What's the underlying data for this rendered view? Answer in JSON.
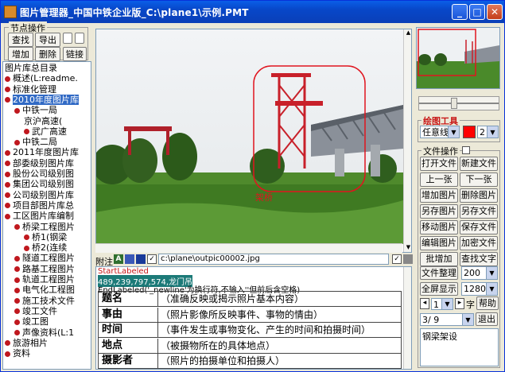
{
  "window": {
    "title": "图片管理器_中国中铁企业版_C:\\plane1\\示例.PMT"
  },
  "titlebar_buttons": {
    "minimize": "_",
    "maximize": "□",
    "close": "✕"
  },
  "node_ops": {
    "label": "节点操作",
    "find": "查找",
    "export": "导出",
    "add": "增加",
    "delete": "删除",
    "link": "链接"
  },
  "tree": {
    "items": [
      {
        "label": "图片库总目录",
        "indent": 0,
        "bullet": false,
        "selected": false
      },
      {
        "label": "概述(L:readme.",
        "indent": 0,
        "bullet": true,
        "selected": false
      },
      {
        "label": "标准化管理",
        "indent": 0,
        "bullet": true,
        "selected": false
      },
      {
        "label": "2010年度图片库",
        "indent": 0,
        "bullet": true,
        "selected": true
      },
      {
        "label": "中铁一局",
        "indent": 1,
        "bullet": true,
        "selected": false
      },
      {
        "label": "京沪高速(",
        "indent": 2,
        "bullet": false,
        "selected": false
      },
      {
        "label": "武广高速",
        "indent": 2,
        "bullet": true,
        "selected": false
      },
      {
        "label": "中铁二局",
        "indent": 1,
        "bullet": true,
        "selected": false
      },
      {
        "label": "2011年度图片库",
        "indent": 0,
        "bullet": true,
        "selected": false
      },
      {
        "label": "部委级别图片库",
        "indent": 0,
        "bullet": true,
        "selected": false
      },
      {
        "label": "股份公司级别图",
        "indent": 0,
        "bullet": true,
        "selected": false
      },
      {
        "label": "集团公司级别图",
        "indent": 0,
        "bullet": true,
        "selected": false
      },
      {
        "label": "公司级别图片库",
        "indent": 0,
        "bullet": true,
        "selected": false
      },
      {
        "label": "项目部图片库总",
        "indent": 0,
        "bullet": true,
        "selected": false
      },
      {
        "label": "工区图片库编制",
        "indent": 0,
        "bullet": true,
        "selected": false
      },
      {
        "label": "桥梁工程图片",
        "indent": 1,
        "bullet": true,
        "selected": false
      },
      {
        "label": "桥1(钢梁",
        "indent": 2,
        "bullet": true,
        "selected": false
      },
      {
        "label": "桥2(连续",
        "indent": 2,
        "bullet": true,
        "selected": false
      },
      {
        "label": "隧道工程图片",
        "indent": 1,
        "bullet": true,
        "selected": false
      },
      {
        "label": "路基工程图片",
        "indent": 1,
        "bullet": true,
        "selected": false
      },
      {
        "label": "轨道工程图片",
        "indent": 1,
        "bullet": true,
        "selected": false
      },
      {
        "label": "电气化工程图",
        "indent": 1,
        "bullet": true,
        "selected": false
      },
      {
        "label": "施工技术文件",
        "indent": 1,
        "bullet": true,
        "selected": false
      },
      {
        "label": "竣工文件",
        "indent": 1,
        "bullet": true,
        "selected": false
      },
      {
        "label": "竣工图",
        "indent": 1,
        "bullet": true,
        "selected": false
      },
      {
        "label": "声像资料(L:1",
        "indent": 1,
        "bullet": true,
        "selected": false
      },
      {
        "label": "旅游相片",
        "indent": 0,
        "bullet": true,
        "selected": false
      },
      {
        "label": "资料",
        "indent": 0,
        "bullet": true,
        "selected": false
      }
    ]
  },
  "image": {
    "annotation_label": "架桥"
  },
  "attach": {
    "label": "附注",
    "path": "c:\\plane\\outpic00002.jpg"
  },
  "notes": {
    "line1": "StartLabeled",
    "line2": "489,239,797,574,龙门吊",
    "line3": "EndLabeled('_newline'为换行符,不输入''但前后含空格)",
    "rows": [
      {
        "k": "题名",
        "v": "（准确反映或揭示照片基本内容）"
      },
      {
        "k": "事由",
        "v": "（照片影像所反映事件、事物的情由）"
      },
      {
        "k": "时间",
        "v": "（事件发生或事物变化、产生的时间和拍摄时间）"
      },
      {
        "k": "地点",
        "v": "（被摄物所在的具体地点）"
      },
      {
        "k": "摄影者",
        "v": "（照片的拍摄单位和拍摄人）"
      }
    ]
  },
  "draw_tools": {
    "label": "绘图工具",
    "shape": "任意线",
    "width": "2",
    "color": "#ff0000"
  },
  "file_ops": {
    "label": "文件操作",
    "buttons": [
      [
        "打开文件",
        "新建文件"
      ],
      [
        "上一张",
        "下一张"
      ],
      [
        "增加图片",
        "删除图片"
      ],
      [
        "另存图片",
        "另存文件"
      ],
      [
        "移动图片",
        "保存文件"
      ],
      [
        "编辑图片",
        "加密文件"
      ],
      [
        "批增加",
        "查找文字"
      ]
    ],
    "arrange": "文件整理",
    "arrange_value": "200",
    "fullscreen": "全屏显示",
    "fullscreen_value": "1280",
    "font_size": "1",
    "font_label": "字",
    "help": "帮助",
    "page": "3/ 9",
    "exit": "退出",
    "caption": "钢梁架设"
  }
}
